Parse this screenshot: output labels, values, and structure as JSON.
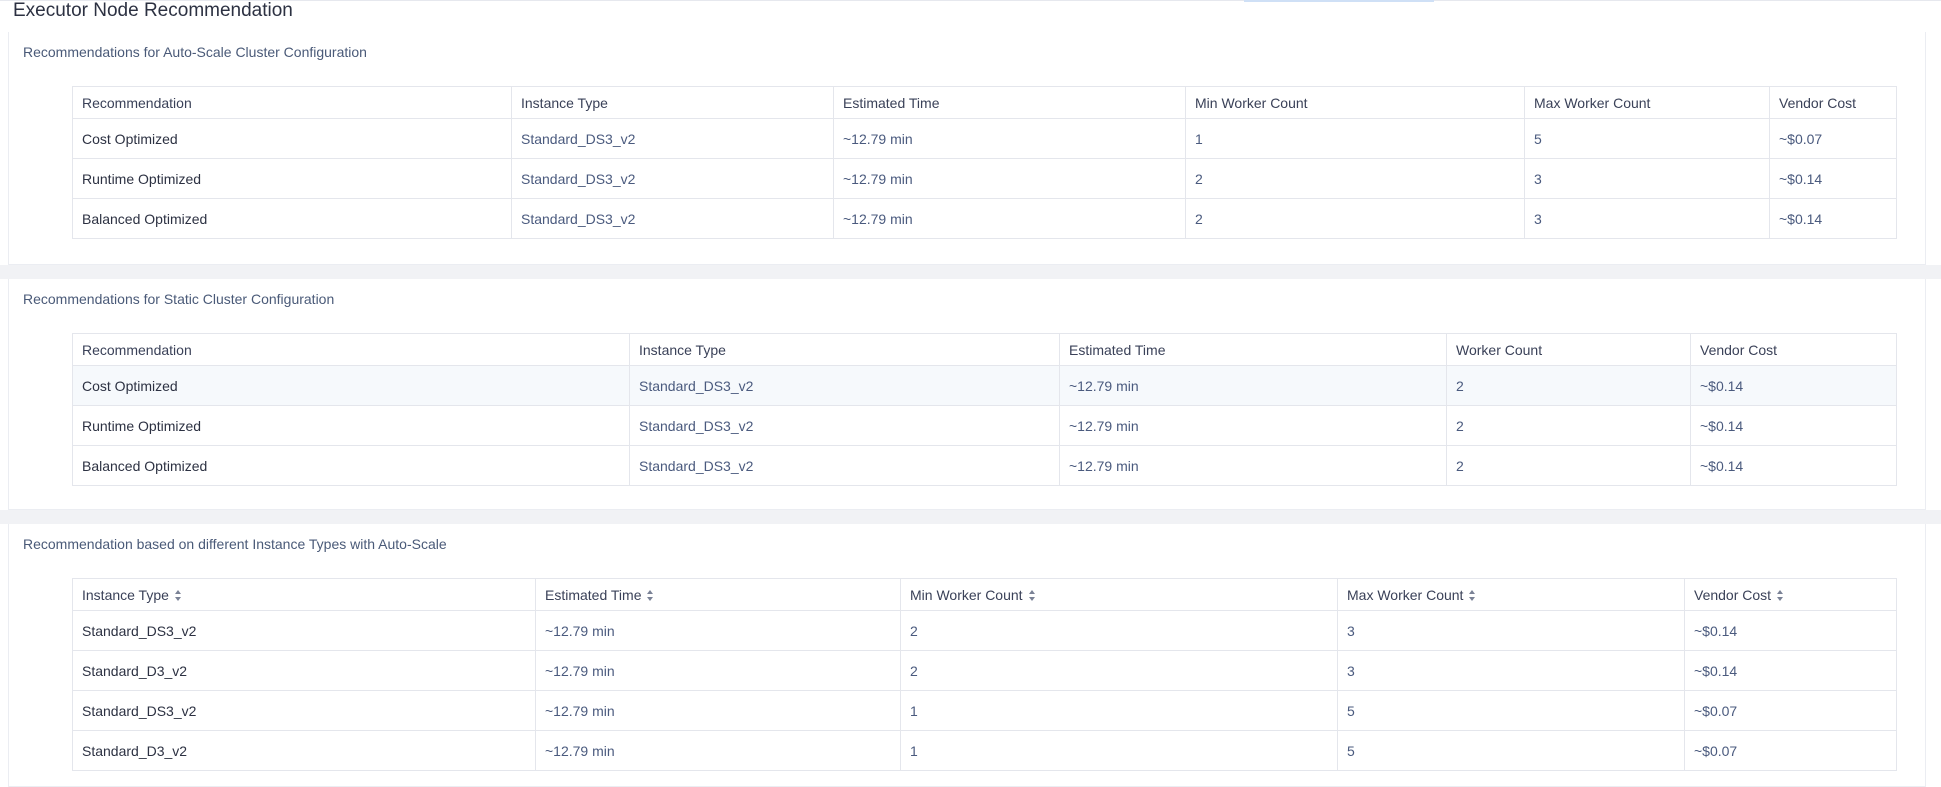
{
  "page": {
    "title": "Executor Node Recommendation"
  },
  "colors": {
    "accent": "#cfe0f6",
    "text": "#2c3142",
    "muted_text": "#4a5a7e",
    "border": "#e4e6ec",
    "separator": "#f1f2f5"
  },
  "autoscale": {
    "title": "Recommendations for Auto-Scale Cluster Configuration",
    "headers": [
      "Recommendation",
      "Instance Type",
      "Estimated Time",
      "Min Worker Count",
      "Max Worker Count",
      "Vendor Cost"
    ],
    "rows": [
      [
        "Cost Optimized",
        "Standard_DS3_v2",
        "~12.79 min",
        "1",
        "5",
        "~$0.07"
      ],
      [
        "Runtime Optimized",
        "Standard_DS3_v2",
        "~12.79 min",
        "2",
        "3",
        "~$0.14"
      ],
      [
        "Balanced Optimized",
        "Standard_DS3_v2",
        "~12.79 min",
        "2",
        "3",
        "~$0.14"
      ]
    ]
  },
  "static": {
    "title": "Recommendations for Static Cluster Configuration",
    "headers": [
      "Recommendation",
      "Instance Type",
      "Estimated Time",
      "Worker Count",
      "Vendor Cost"
    ],
    "rows": [
      [
        "Cost Optimized",
        "Standard_DS3_v2",
        "~12.79 min",
        "2",
        "~$0.14"
      ],
      [
        "Runtime Optimized",
        "Standard_DS3_v2",
        "~12.79 min",
        "2",
        "~$0.14"
      ],
      [
        "Balanced Optimized",
        "Standard_DS3_v2",
        "~12.79 min",
        "2",
        "~$0.14"
      ]
    ]
  },
  "instances": {
    "title": "Recommendation based on different Instance Types with Auto-Scale",
    "headers": [
      "Instance Type",
      "Estimated Time",
      "Min Worker Count",
      "Max Worker Count",
      "Vendor Cost"
    ],
    "rows": [
      [
        "Standard_DS3_v2",
        "~12.79 min",
        "2",
        "3",
        "~$0.14"
      ],
      [
        "Standard_D3_v2",
        "~12.79 min",
        "2",
        "3",
        "~$0.14"
      ],
      [
        "Standard_DS3_v2",
        "~12.79 min",
        "1",
        "5",
        "~$0.07"
      ],
      [
        "Standard_D3_v2",
        "~12.79 min",
        "1",
        "5",
        "~$0.07"
      ]
    ]
  }
}
